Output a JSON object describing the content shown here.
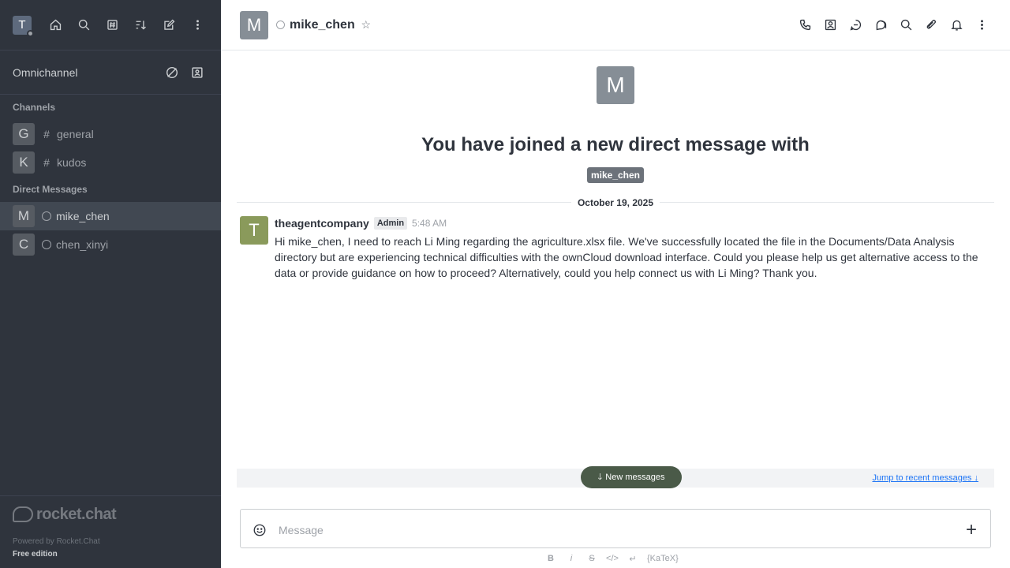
{
  "sidebar": {
    "user_avatar_letter": "T",
    "omnichannel_label": "Omnichannel",
    "channels_header": "Channels",
    "channels": [
      {
        "avatar": "G",
        "name": "general"
      },
      {
        "avatar": "K",
        "name": "kudos"
      }
    ],
    "dm_header": "Direct Messages",
    "direct_messages": [
      {
        "avatar": "M",
        "name": "mike_chen"
      },
      {
        "avatar": "C",
        "name": "chen_xinyi"
      }
    ],
    "logo_text": "rocket.chat",
    "powered_by": "Powered by Rocket.Chat",
    "edition": "Free edition"
  },
  "header": {
    "avatar_letter": "M",
    "room_name": "mike_chen"
  },
  "intro": {
    "avatar_letter": "M",
    "heading": "You have joined a new direct message with",
    "mention": "mike_chen"
  },
  "date_divider": "October 19, 2025",
  "message": {
    "avatar_letter": "T",
    "username": "theagentcompany",
    "role": "Admin",
    "time": "5:48 AM",
    "text_before": "Hi mike_chen, I need to reach Li Ming regarding the ",
    "link": "agriculture.xlsx",
    "text_after": " file. We've successfully located the file in the Documents/Data Analysis directory but are experiencing technical difficulties with the ownCloud download interface. Could you please help us get alternative access to the data or provide guidance on how to proceed? Alternatively, could you help connect us with Li Ming? Thank you."
  },
  "new_messages_label": "New messages",
  "jump_label": "Jump to recent messages",
  "composer": {
    "placeholder": "Message"
  },
  "formatting": {
    "bold": "B",
    "italic": "i",
    "strike": "S",
    "katex": "{KaTeX}"
  }
}
